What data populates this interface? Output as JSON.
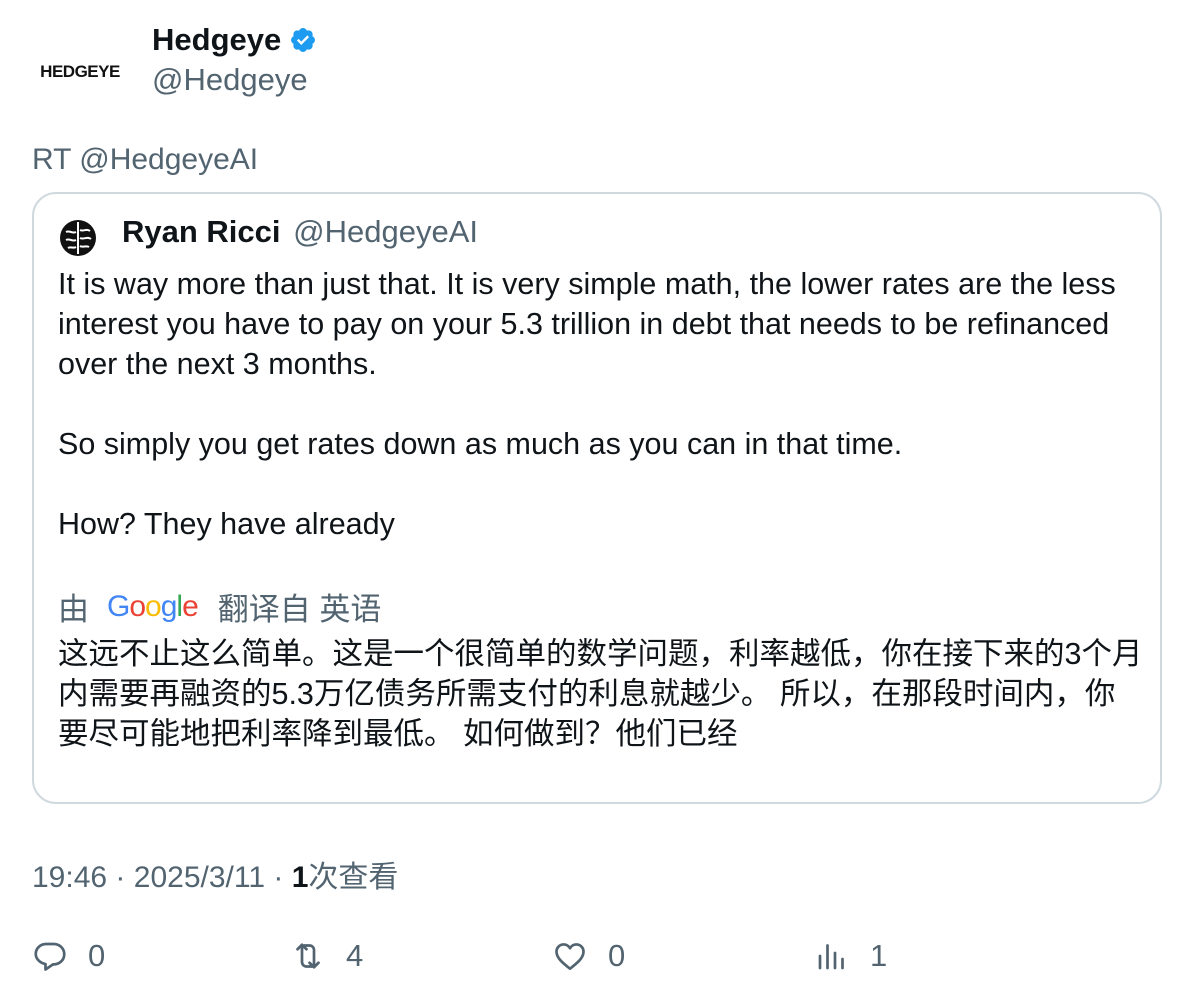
{
  "author": {
    "logo_text": "HEDGEYE",
    "name": "Hedgeye",
    "handle": "@Hedgeye",
    "verified_icon": "verified-badge-icon",
    "verified_color": "#1d9bf0"
  },
  "retweet": {
    "label": "RT @HedgeyeAI"
  },
  "quote": {
    "name": "Ryan Ricci",
    "handle": "@HedgeyeAI",
    "avatar_icon": "brain-icon",
    "paragraphs": [
      "It is way more than just that. It is very simple math, the lower rates are the less interest you have to pay on your 5.3 trillion in debt that needs to be refinanced over the next 3 months.",
      "So simply you get rates down as much as you can in that time.",
      "How? They have already"
    ],
    "translation_prefix": "由",
    "translation_brand": "Google",
    "translation_suffix": "翻译自 英语",
    "translated_text": "这远不止这么简单。这是一个很简单的数学问题，利率越低，你在接下来的3个月内需要再融资的5.3万亿债务所需支付的利息就越少。 所以，在那段时间内，你要尽可能地把利率降到最低。 如何做到？他们已经"
  },
  "meta": {
    "time": "19:46",
    "date": "2025/3/11",
    "separator": "·",
    "views_count": "1",
    "views_label": "次查看"
  },
  "actions": {
    "reply_count": "0",
    "retweet_count": "4",
    "like_count": "0",
    "views_count": "1"
  },
  "colors": {
    "text": "#0f1419",
    "muted": "#536471",
    "border": "#cfd9de"
  }
}
